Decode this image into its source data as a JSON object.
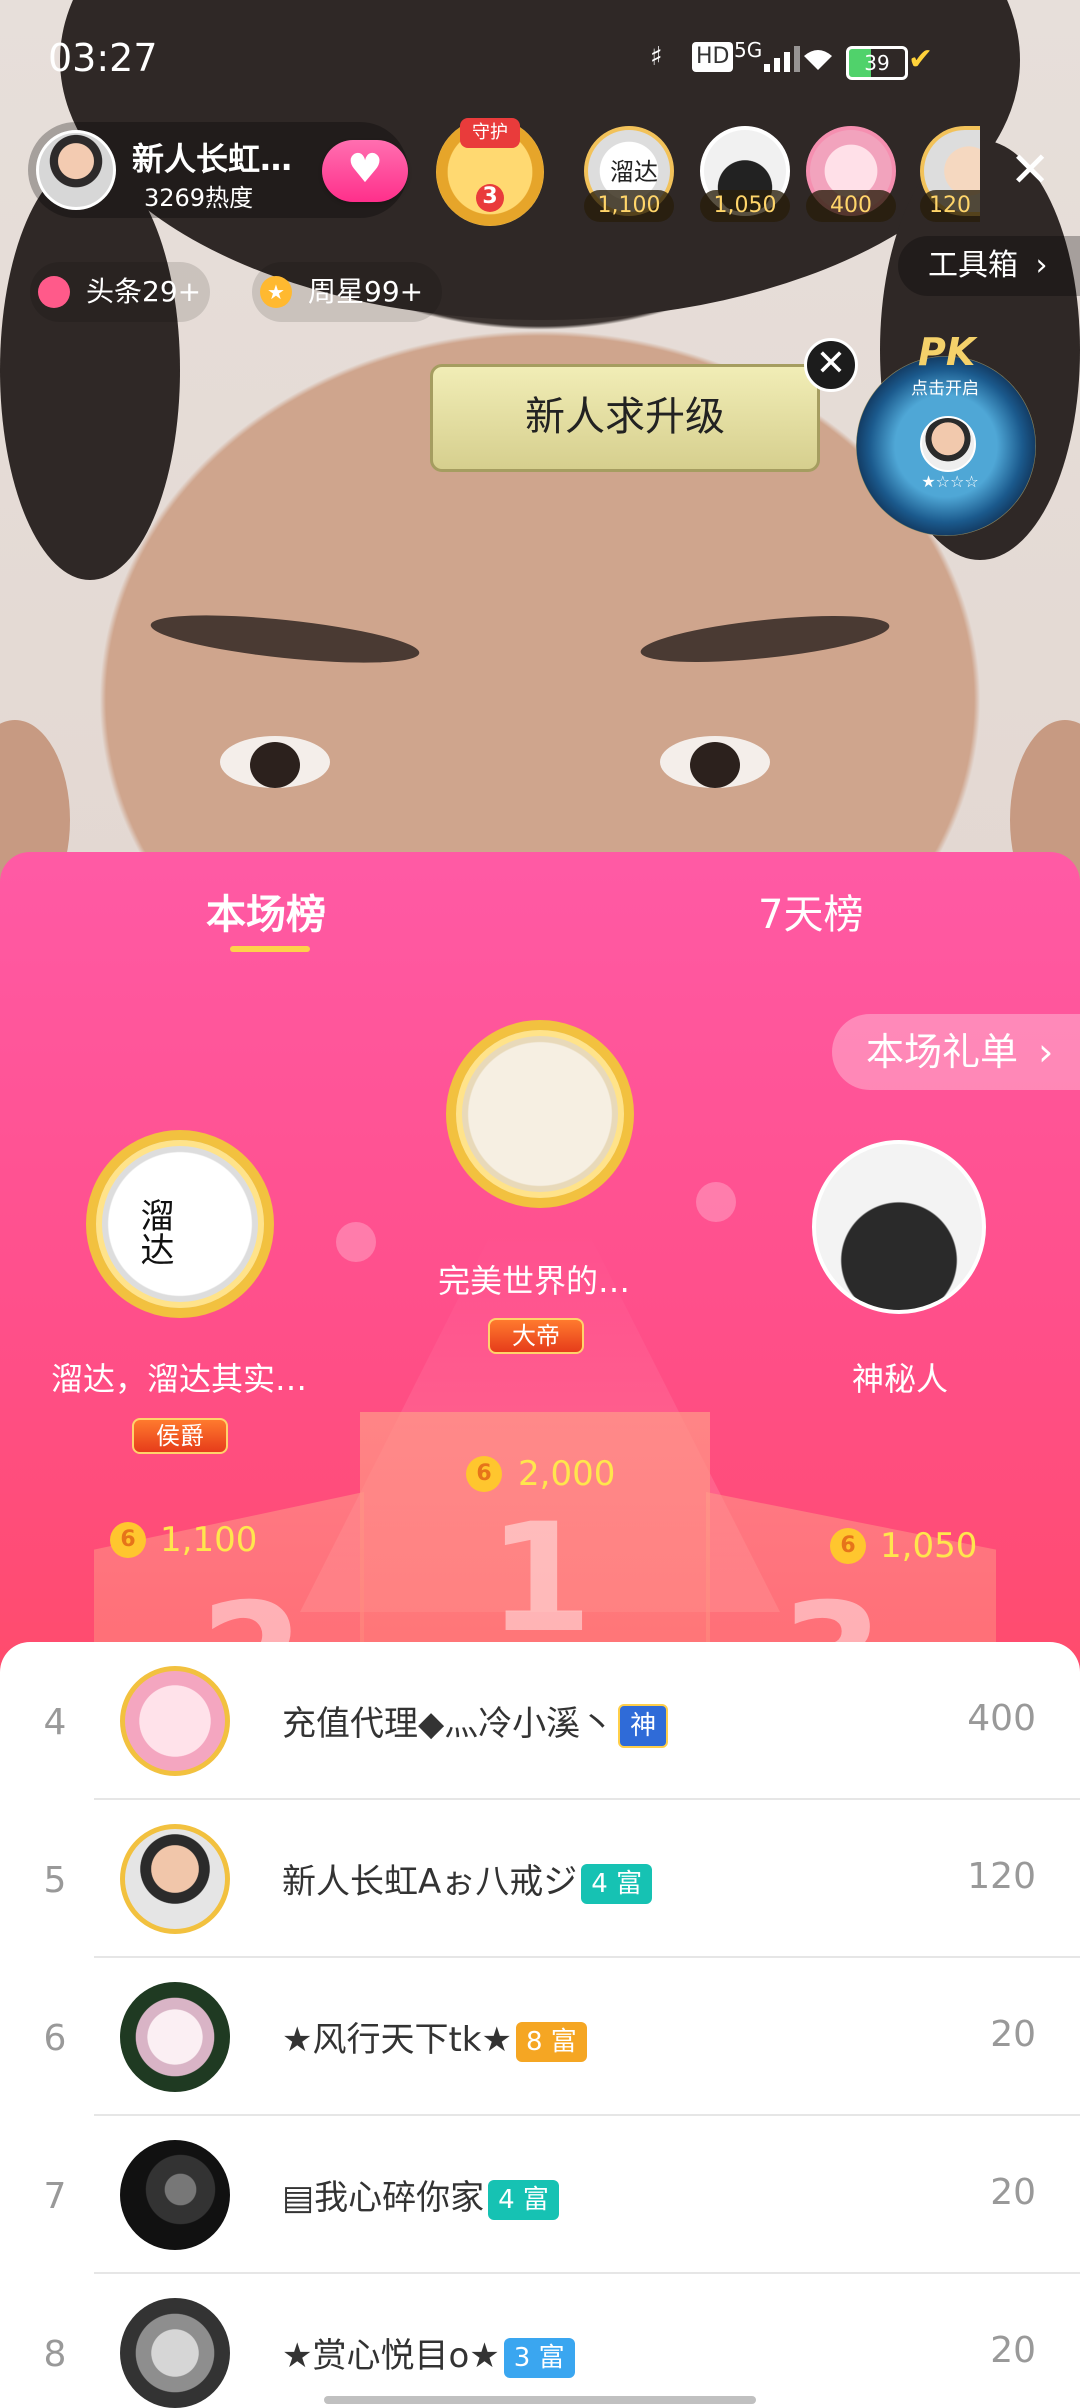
{
  "status_bar": {
    "time": "03:27",
    "battery": "39",
    "network": "5G",
    "hd": "HD"
  },
  "anchor": {
    "name": "新人长虹…",
    "heat": "3269热度"
  },
  "guard": {
    "level": "3",
    "title": "守护"
  },
  "viewers": [
    {
      "value": "1,100",
      "text": "溜达"
    },
    {
      "value": "1,050"
    },
    {
      "value": "400"
    },
    {
      "value": "120"
    }
  ],
  "toolbox": {
    "label": "工具箱"
  },
  "tags": [
    {
      "label": "头条29+"
    },
    {
      "label": "周星99+"
    }
  ],
  "banner": {
    "text": "新人求升级"
  },
  "pk": {
    "label": "PK",
    "hint": "点击开启",
    "stars": "★☆☆☆"
  },
  "rank": {
    "tabs": [
      {
        "label": "本场榜",
        "active": true
      },
      {
        "label": "7天榜",
        "active": false
      }
    ],
    "gift_list": "本场礼单",
    "podium": [
      {
        "place": "2",
        "name": "溜达，溜达其实…",
        "badge": "侯爵",
        "score": "1,100",
        "avatar_text": "溜达"
      },
      {
        "place": "1",
        "name": "完美世界的…",
        "badge": "大帝",
        "score": "2,000"
      },
      {
        "place": "3",
        "name": "神秘人",
        "score": "1,050"
      }
    ],
    "coin_symbol": "6"
  },
  "list": [
    {
      "rank": "4",
      "name": "充值代理◆灬冷小溪丶",
      "badge": "神",
      "score": "400",
      "color": "#2f6bd8"
    },
    {
      "rank": "5",
      "name": "新人长虹Aぉ八戒ジ",
      "badge": "4 富",
      "score": "120",
      "color": "#16c2b3"
    },
    {
      "rank": "6",
      "name": "★风行天下tk★",
      "badge": "8 富",
      "score": "20",
      "color": "#f5a623"
    },
    {
      "rank": "7",
      "name": "▤我心碎你家",
      "badge": "4 富",
      "score": "20",
      "color": "#16c2b3"
    },
    {
      "rank": "8",
      "name": "★赏心悦目o★",
      "badge": "3 富",
      "score": "20",
      "color": "#3aa6f0"
    }
  ]
}
